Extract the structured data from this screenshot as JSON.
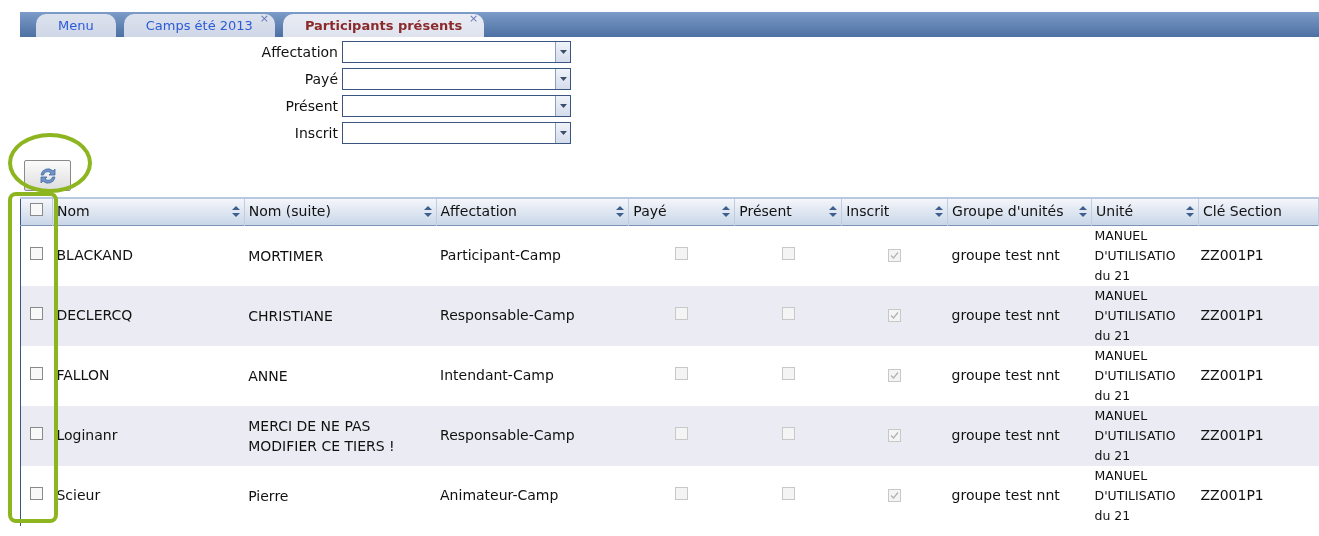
{
  "tabs": [
    {
      "label": "Menu",
      "selected": false
    },
    {
      "label": "Camps été 2013",
      "selected": false,
      "close": "×"
    },
    {
      "label": "Participants présents",
      "selected": true,
      "close": "×"
    }
  ],
  "filters": [
    {
      "label": "Affectation"
    },
    {
      "label": "Payé"
    },
    {
      "label": "Présent"
    },
    {
      "label": "Inscrit"
    }
  ],
  "table": {
    "select_all_checked": false,
    "columns": [
      {
        "label": "Nom",
        "sortable": true
      },
      {
        "label": "Nom (suite)",
        "sortable": true
      },
      {
        "label": "Affectation",
        "sortable": true
      },
      {
        "label": "Payé",
        "sortable": true
      },
      {
        "label": "Présent",
        "sortable": true
      },
      {
        "label": "Inscrit",
        "sortable": true
      },
      {
        "label": "Groupe d'unités",
        "sortable": true
      },
      {
        "label": "Unité",
        "sortable": true
      },
      {
        "label": "Clé Section",
        "sortable": false
      }
    ],
    "rows": [
      {
        "checked": false,
        "nom": "BLACKAND",
        "suite": "MORTIMER",
        "affectation": "Participant-Camp",
        "paye": false,
        "present": false,
        "inscrit": true,
        "groupe": "groupe test nnt",
        "unite": "MANUEL D'UTILISATIO du 21",
        "cle": "ZZ001P1"
      },
      {
        "checked": false,
        "nom": "DECLERCQ",
        "suite": "CHRISTIANE",
        "affectation": "Responsable-Camp",
        "paye": false,
        "present": false,
        "inscrit": true,
        "groupe": "groupe test nnt",
        "unite": "MANUEL D'UTILISATIO du 21",
        "cle": "ZZ001P1"
      },
      {
        "checked": false,
        "nom": "FALLON",
        "suite": "ANNE",
        "affectation": "Intendant-Camp",
        "paye": false,
        "present": false,
        "inscrit": true,
        "groupe": "groupe test nnt",
        "unite": "MANUEL D'UTILISATIO du 21",
        "cle": "ZZ001P1"
      },
      {
        "checked": false,
        "nom": "Loginanr",
        "suite": "MERCI DE NE PAS MODIFIER CE TIERS !",
        "affectation": "Responsable-Camp",
        "paye": false,
        "present": false,
        "inscrit": true,
        "groupe": "groupe test nnt",
        "unite": "MANUEL D'UTILISATIO du 21",
        "cle": "ZZ001P1"
      },
      {
        "checked": false,
        "nom": "Scieur",
        "suite": "Pierre",
        "affectation": "Animateur-Camp",
        "paye": false,
        "present": false,
        "inscrit": true,
        "groupe": "groupe test nnt",
        "unite": "MANUEL D'UTILISATIO du 21",
        "cle": "ZZ001P1"
      }
    ]
  }
}
